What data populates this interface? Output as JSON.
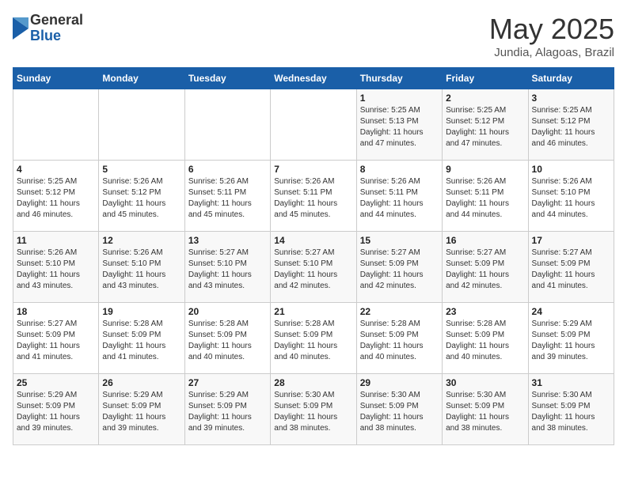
{
  "header": {
    "logo_general": "General",
    "logo_blue": "Blue",
    "month_title": "May 2025",
    "location": "Jundia, Alagoas, Brazil"
  },
  "weekdays": [
    "Sunday",
    "Monday",
    "Tuesday",
    "Wednesday",
    "Thursday",
    "Friday",
    "Saturday"
  ],
  "weeks": [
    [
      {
        "day": "",
        "info": ""
      },
      {
        "day": "",
        "info": ""
      },
      {
        "day": "",
        "info": ""
      },
      {
        "day": "",
        "info": ""
      },
      {
        "day": "1",
        "info": "Sunrise: 5:25 AM\nSunset: 5:13 PM\nDaylight: 11 hours\nand 47 minutes."
      },
      {
        "day": "2",
        "info": "Sunrise: 5:25 AM\nSunset: 5:12 PM\nDaylight: 11 hours\nand 47 minutes."
      },
      {
        "day": "3",
        "info": "Sunrise: 5:25 AM\nSunset: 5:12 PM\nDaylight: 11 hours\nand 46 minutes."
      }
    ],
    [
      {
        "day": "4",
        "info": "Sunrise: 5:25 AM\nSunset: 5:12 PM\nDaylight: 11 hours\nand 46 minutes."
      },
      {
        "day": "5",
        "info": "Sunrise: 5:26 AM\nSunset: 5:12 PM\nDaylight: 11 hours\nand 45 minutes."
      },
      {
        "day": "6",
        "info": "Sunrise: 5:26 AM\nSunset: 5:11 PM\nDaylight: 11 hours\nand 45 minutes."
      },
      {
        "day": "7",
        "info": "Sunrise: 5:26 AM\nSunset: 5:11 PM\nDaylight: 11 hours\nand 45 minutes."
      },
      {
        "day": "8",
        "info": "Sunrise: 5:26 AM\nSunset: 5:11 PM\nDaylight: 11 hours\nand 44 minutes."
      },
      {
        "day": "9",
        "info": "Sunrise: 5:26 AM\nSunset: 5:11 PM\nDaylight: 11 hours\nand 44 minutes."
      },
      {
        "day": "10",
        "info": "Sunrise: 5:26 AM\nSunset: 5:10 PM\nDaylight: 11 hours\nand 44 minutes."
      }
    ],
    [
      {
        "day": "11",
        "info": "Sunrise: 5:26 AM\nSunset: 5:10 PM\nDaylight: 11 hours\nand 43 minutes."
      },
      {
        "day": "12",
        "info": "Sunrise: 5:26 AM\nSunset: 5:10 PM\nDaylight: 11 hours\nand 43 minutes."
      },
      {
        "day": "13",
        "info": "Sunrise: 5:27 AM\nSunset: 5:10 PM\nDaylight: 11 hours\nand 43 minutes."
      },
      {
        "day": "14",
        "info": "Sunrise: 5:27 AM\nSunset: 5:10 PM\nDaylight: 11 hours\nand 42 minutes."
      },
      {
        "day": "15",
        "info": "Sunrise: 5:27 AM\nSunset: 5:09 PM\nDaylight: 11 hours\nand 42 minutes."
      },
      {
        "day": "16",
        "info": "Sunrise: 5:27 AM\nSunset: 5:09 PM\nDaylight: 11 hours\nand 42 minutes."
      },
      {
        "day": "17",
        "info": "Sunrise: 5:27 AM\nSunset: 5:09 PM\nDaylight: 11 hours\nand 41 minutes."
      }
    ],
    [
      {
        "day": "18",
        "info": "Sunrise: 5:27 AM\nSunset: 5:09 PM\nDaylight: 11 hours\nand 41 minutes."
      },
      {
        "day": "19",
        "info": "Sunrise: 5:28 AM\nSunset: 5:09 PM\nDaylight: 11 hours\nand 41 minutes."
      },
      {
        "day": "20",
        "info": "Sunrise: 5:28 AM\nSunset: 5:09 PM\nDaylight: 11 hours\nand 40 minutes."
      },
      {
        "day": "21",
        "info": "Sunrise: 5:28 AM\nSunset: 5:09 PM\nDaylight: 11 hours\nand 40 minutes."
      },
      {
        "day": "22",
        "info": "Sunrise: 5:28 AM\nSunset: 5:09 PM\nDaylight: 11 hours\nand 40 minutes."
      },
      {
        "day": "23",
        "info": "Sunrise: 5:28 AM\nSunset: 5:09 PM\nDaylight: 11 hours\nand 40 minutes."
      },
      {
        "day": "24",
        "info": "Sunrise: 5:29 AM\nSunset: 5:09 PM\nDaylight: 11 hours\nand 39 minutes."
      }
    ],
    [
      {
        "day": "25",
        "info": "Sunrise: 5:29 AM\nSunset: 5:09 PM\nDaylight: 11 hours\nand 39 minutes."
      },
      {
        "day": "26",
        "info": "Sunrise: 5:29 AM\nSunset: 5:09 PM\nDaylight: 11 hours\nand 39 minutes."
      },
      {
        "day": "27",
        "info": "Sunrise: 5:29 AM\nSunset: 5:09 PM\nDaylight: 11 hours\nand 39 minutes."
      },
      {
        "day": "28",
        "info": "Sunrise: 5:30 AM\nSunset: 5:09 PM\nDaylight: 11 hours\nand 38 minutes."
      },
      {
        "day": "29",
        "info": "Sunrise: 5:30 AM\nSunset: 5:09 PM\nDaylight: 11 hours\nand 38 minutes."
      },
      {
        "day": "30",
        "info": "Sunrise: 5:30 AM\nSunset: 5:09 PM\nDaylight: 11 hours\nand 38 minutes."
      },
      {
        "day": "31",
        "info": "Sunrise: 5:30 AM\nSunset: 5:09 PM\nDaylight: 11 hours\nand 38 minutes."
      }
    ]
  ]
}
